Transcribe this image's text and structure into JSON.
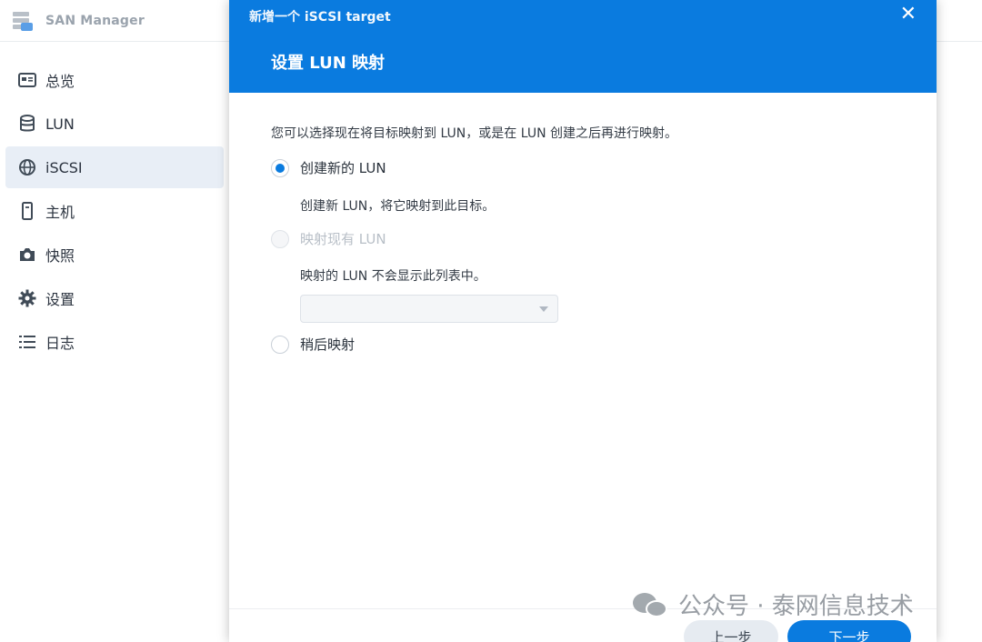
{
  "app": {
    "title": "SAN Manager"
  },
  "sidebar": {
    "items": [
      {
        "label": "总览",
        "icon": "overview-icon"
      },
      {
        "label": "LUN",
        "icon": "database-icon"
      },
      {
        "label": "iSCSI",
        "icon": "globe-icon",
        "active": true
      },
      {
        "label": "主机",
        "icon": "host-icon"
      },
      {
        "label": "快照",
        "icon": "camera-icon"
      },
      {
        "label": "设置",
        "icon": "gear-icon"
      },
      {
        "label": "日志",
        "icon": "list-icon"
      }
    ]
  },
  "modal": {
    "window_title": "新增一个 iSCSI target",
    "close_icon": "close-icon",
    "step_title": "设置 LUN 映射",
    "intro": "您可以选择现在将目标映射到 LUN，或是在 LUN 创建之后再进行映射。",
    "options": [
      {
        "label": "创建新的 LUN",
        "checked": true,
        "disabled": false,
        "hint": "创建新 LUN，将它映射到此目标。"
      },
      {
        "label": "映射现有 LUN",
        "checked": false,
        "disabled": true,
        "hint": "映射的 LUN 不会显示此列表中。"
      },
      {
        "label": "稍后映射",
        "checked": false,
        "disabled": false
      }
    ],
    "select_value": "",
    "buttons": {
      "prev": "上一步",
      "next": "下一步"
    }
  },
  "watermark": {
    "text": "公众号 · 泰网信息技术"
  },
  "colors": {
    "accent": "#0a7bdf",
    "sidebar_active": "#e8eef6"
  }
}
